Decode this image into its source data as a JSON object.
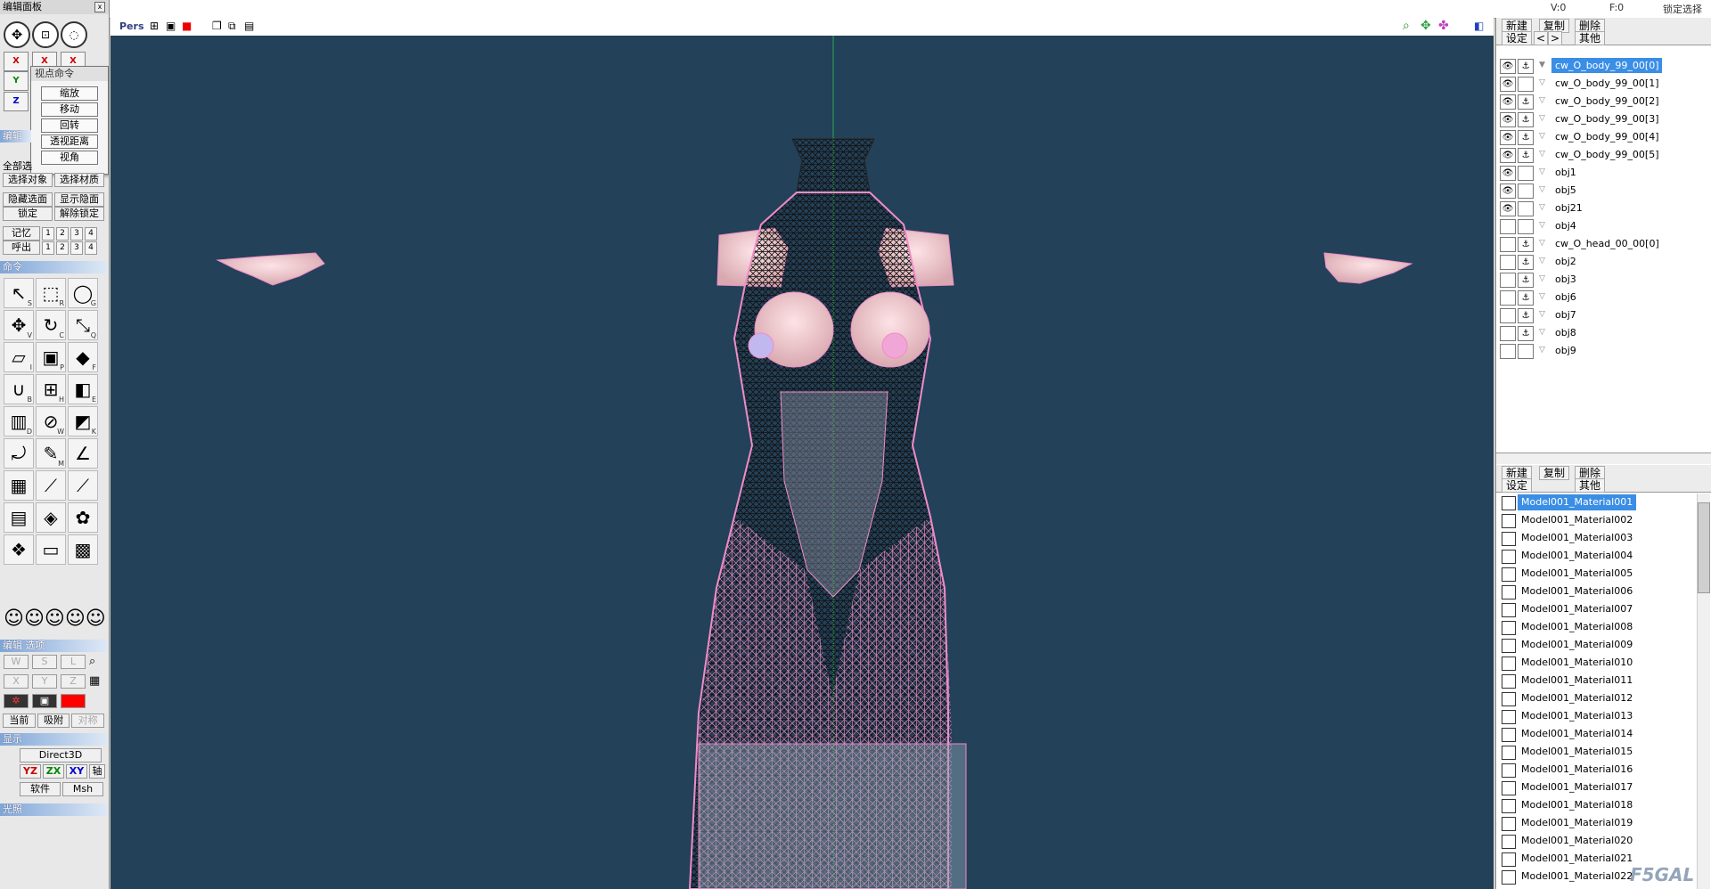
{
  "top": {
    "v_label": "V:0",
    "f_label": "F:0",
    "lock_select": "锁定选择"
  },
  "left": {
    "title": "编辑面板",
    "close": "x",
    "axes": {
      "x": "X",
      "y": "Y",
      "z": "Z"
    },
    "popup": {
      "title": "视点命令",
      "items": [
        "缩放",
        "移动",
        "回转",
        "透视距离",
        "视角"
      ]
    },
    "edit_header": "编辑",
    "select_all": "全部选",
    "row_select": [
      "选择对象",
      "选择材质"
    ],
    "row_hide": [
      "隐藏选面",
      "显示隐面"
    ],
    "row_lock": [
      "锁定",
      "解除锁定"
    ],
    "memory_label": "记忆",
    "recall_label": "呼出",
    "nums": [
      "1",
      "2",
      "3",
      "4"
    ],
    "command_header": "命令",
    "tool_keys": [
      "S",
      "R",
      "G",
      "V",
      "C",
      "Q",
      "I",
      "P",
      "F",
      "B",
      "H",
      "E",
      "D",
      "W",
      "K",
      "",
      "M",
      "",
      "",
      "",
      "",
      "",
      "",
      "",
      "",
      "",
      ""
    ],
    "edit_options_header": "编辑 选项",
    "opt_row1": [
      "W",
      "S",
      "L"
    ],
    "opt_row2": [
      "X",
      "Y",
      "Z"
    ],
    "row_current": [
      "当前",
      "吸附",
      "对称"
    ],
    "display_header": "显示",
    "direct3d": "Direct3D",
    "plane_btns": [
      "YZ",
      "ZX",
      "XY",
      "轴"
    ],
    "soft_btn": "软件",
    "msh_btn": "Msh",
    "light_header": "光照"
  },
  "viewport": {
    "mode": "Pers",
    "colors": {
      "background": "#234159",
      "wire_pink": "#f08cc8",
      "wire_black": "#111111",
      "skin": "#f2c9cf"
    }
  },
  "objects": {
    "toolbar": {
      "new": "新建",
      "copy": "复制",
      "delete": "删除",
      "settings": "设定",
      "prev": "<",
      "next": ">",
      "other": "其他"
    },
    "rows": [
      {
        "name": "cw_O_body_99_00[0]",
        "eye": "👁",
        "lock": "⚓",
        "selected": true
      },
      {
        "name": "cw_O_body_99_00[1]",
        "eye": "👁",
        "lock": ""
      },
      {
        "name": "cw_O_body_99_00[2]",
        "eye": "👁",
        "lock": "⚓"
      },
      {
        "name": "cw_O_body_99_00[3]",
        "eye": "👁",
        "lock": "⚓"
      },
      {
        "name": "cw_O_body_99_00[4]",
        "eye": "👁",
        "lock": "⚓"
      },
      {
        "name": "cw_O_body_99_00[5]",
        "eye": "👁",
        "lock": "⚓"
      },
      {
        "name": "obj1",
        "eye": "👁",
        "lock": ""
      },
      {
        "name": "obj5",
        "eye": "👁",
        "lock": ""
      },
      {
        "name": "obj21",
        "eye": "👁",
        "lock": ""
      },
      {
        "name": "obj4",
        "eye": "",
        "lock": ""
      },
      {
        "name": "cw_O_head_00_00[0]",
        "eye": "",
        "lock": "⚓"
      },
      {
        "name": "obj2",
        "eye": "",
        "lock": "⚓"
      },
      {
        "name": "obj3",
        "eye": "",
        "lock": "⚓"
      },
      {
        "name": "obj6",
        "eye": "",
        "lock": "⚓"
      },
      {
        "name": "obj7",
        "eye": "",
        "lock": "⚓"
      },
      {
        "name": "obj8",
        "eye": "",
        "lock": "⚓"
      },
      {
        "name": "obj9",
        "eye": "",
        "lock": ""
      }
    ]
  },
  "materials": {
    "toolbar": {
      "new": "新建",
      "copy": "复制",
      "delete": "删除",
      "settings": "设定",
      "other": "其他"
    },
    "rows": [
      "Model001_Material001",
      "Model001_Material002",
      "Model001_Material003",
      "Model001_Material004",
      "Model001_Material005",
      "Model001_Material006",
      "Model001_Material007",
      "Model001_Material008",
      "Model001_Material009",
      "Model001_Material010",
      "Model001_Material011",
      "Model001_Material012",
      "Model001_Material013",
      "Model001_Material014",
      "Model001_Material015",
      "Model001_Material016",
      "Model001_Material017",
      "Model001_Material018",
      "Model001_Material019",
      "Model001_Material020",
      "Model001_Material021",
      "Model001_Material022"
    ],
    "watermark": "F5GAL"
  }
}
